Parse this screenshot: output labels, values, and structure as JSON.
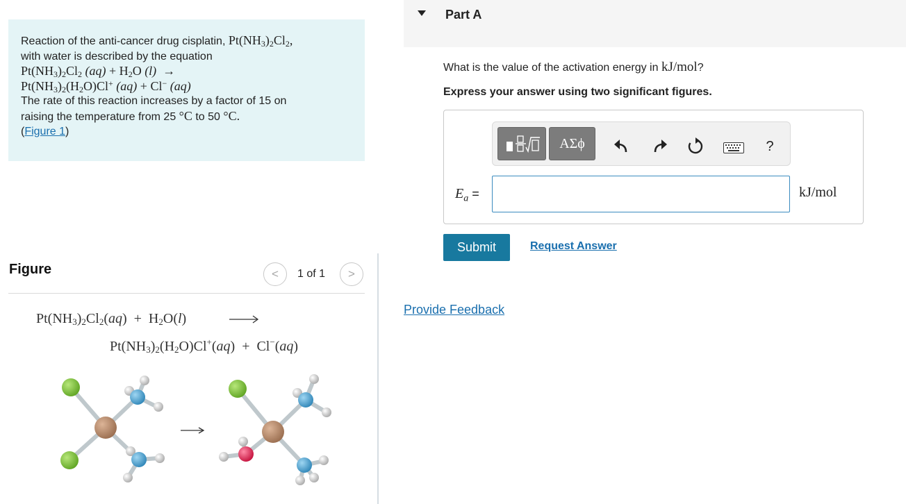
{
  "problem": {
    "intro_1": "Reaction of the anti-cancer drug cisplatin, ",
    "intro_2": "with water is described by the equation",
    "rate_text_1": "The rate of this reaction increases by a factor of 15 on",
    "rate_text_2": "raising the temperature from 25 ",
    "rate_text_3": " to 50 ",
    "degC": "°C",
    "figure_link": "Figure 1"
  },
  "figure": {
    "title": "Figure",
    "count": "1 of 1",
    "prev_glyph": "<",
    "next_glyph": ">"
  },
  "part": {
    "title": "Part A",
    "question_1": "What is the value of the activation energy in ",
    "question_unit": "kJ/mol",
    "question_end": "?",
    "instruction": "Express your answer using two significant figures.",
    "symbols_label": "ΑΣϕ",
    "help_label": "?",
    "ea_equals": " =",
    "answer_value": "",
    "unit": "kJ/mol",
    "submit_label": "Submit",
    "request_answer_label": "Request Answer"
  },
  "footer": {
    "feedback_label": "Provide Feedback"
  },
  "colors": {
    "problem_bg": "#e4f4f6",
    "accent": "#18799f",
    "link": "#1a6fae",
    "cl_atom": "#7cc23a",
    "pt_atom": "#b98a6a",
    "n_atom": "#4aa3d3",
    "o_atom": "#e22a55",
    "h_atom": "#d7d7d7"
  }
}
